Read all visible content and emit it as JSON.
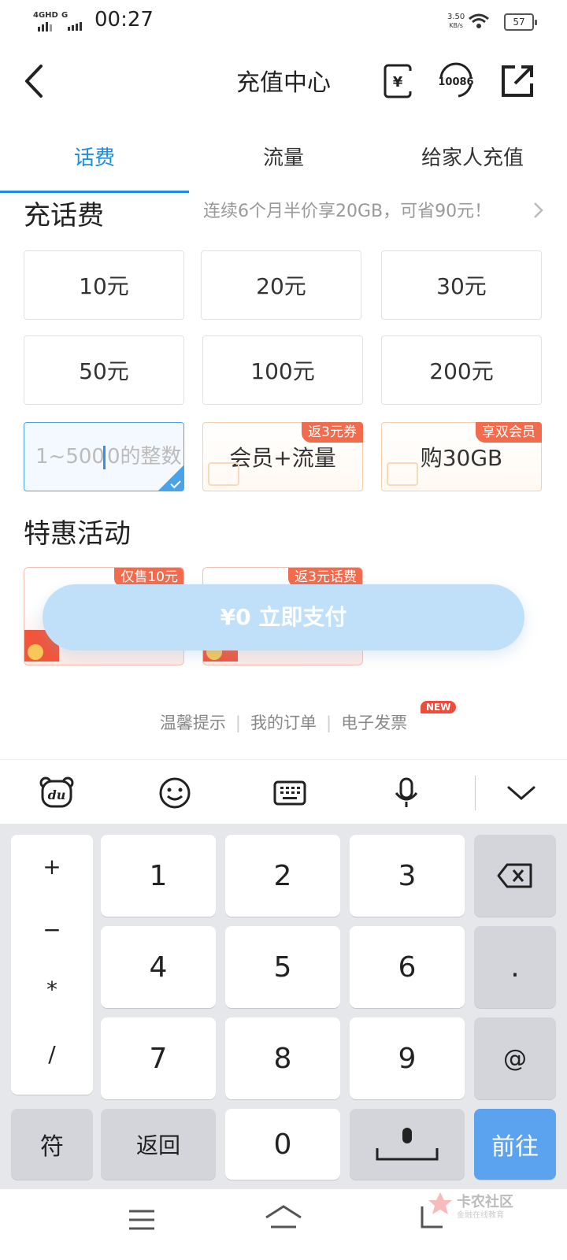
{
  "status_bar": {
    "network1": "4GHD",
    "network2": "G",
    "time": "00:27",
    "net_speed_value": "3.50",
    "net_speed_unit": "KB/s",
    "battery": "57"
  },
  "header": {
    "title": "充值中心",
    "service_icon_label": "10086"
  },
  "tabs": [
    {
      "label": "话费",
      "active": true
    },
    {
      "label": "流量",
      "active": false
    },
    {
      "label": "给家人充值",
      "active": false
    }
  ],
  "recharge": {
    "title": "充话费",
    "promo": "连续6个月半价享20GB，可省90元！",
    "amounts": [
      "10元",
      "20元",
      "30元",
      "50元",
      "100元",
      "200元"
    ],
    "custom_placeholder_before": "1~500",
    "custom_placeholder_after": "0的整数",
    "special_options": [
      {
        "label": "会员+流量",
        "badge": "返3元券"
      },
      {
        "label": "购30GB",
        "badge": "享双会员"
      }
    ]
  },
  "activities": {
    "title": "特惠活动",
    "items": [
      {
        "badge": "仅售10元"
      },
      {
        "badge": "返3元话费"
      }
    ]
  },
  "pay_button": "¥0 立即支付",
  "footer_links": [
    "温馨提示",
    "我的订单",
    "电子发票"
  ],
  "new_badge": "NEW",
  "keyboard": {
    "toolbar_logo": "du",
    "symbols": [
      "+",
      "−",
      "*",
      "/"
    ],
    "digits": [
      "1",
      "2",
      "3",
      "4",
      "5",
      "6",
      "7",
      "8",
      "9",
      "0"
    ],
    "dot": ".",
    "at": "@",
    "sym_key": "符",
    "back_key": "返回",
    "go_key": "前往"
  },
  "watermark": {
    "text": "卡农社区",
    "sub": "金融在线教育"
  },
  "colors": {
    "accent": "#1a8fe0",
    "badge": "#f26b4c",
    "pay_button": "#bfe0f8",
    "go_key": "#5ba3ee"
  }
}
